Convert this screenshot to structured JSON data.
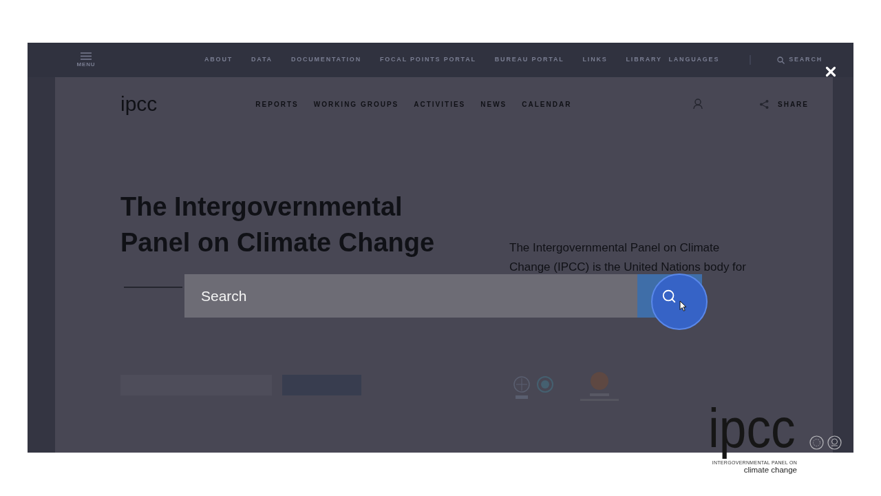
{
  "top_nav": {
    "menu_label": "MENU",
    "links": [
      "ABOUT",
      "DATA",
      "DOCUMENTATION",
      "FOCAL POINTS PORTAL",
      "BUREAU PORTAL",
      "LINKS",
      "LIBRARY"
    ],
    "languages": "LANGUAGES",
    "search": "SEARCH"
  },
  "header": {
    "logo": "ipcc",
    "links": [
      "REPORTS",
      "WORKING GROUPS",
      "ACTIVITIES",
      "NEWS",
      "CALENDAR"
    ],
    "share": "SHARE"
  },
  "hero": {
    "title": "The Intergovernmental Panel on Climate Change",
    "intro": "The Intergovernmental Panel on Climate Change (IPCC) is the United Nations body for"
  },
  "search_overlay": {
    "placeholder": "Search"
  },
  "video_logo": {
    "wordmark": "ipcc",
    "line_1": "INTERGOVERNMENTAL PANEL ON",
    "line_2": "climate change"
  }
}
